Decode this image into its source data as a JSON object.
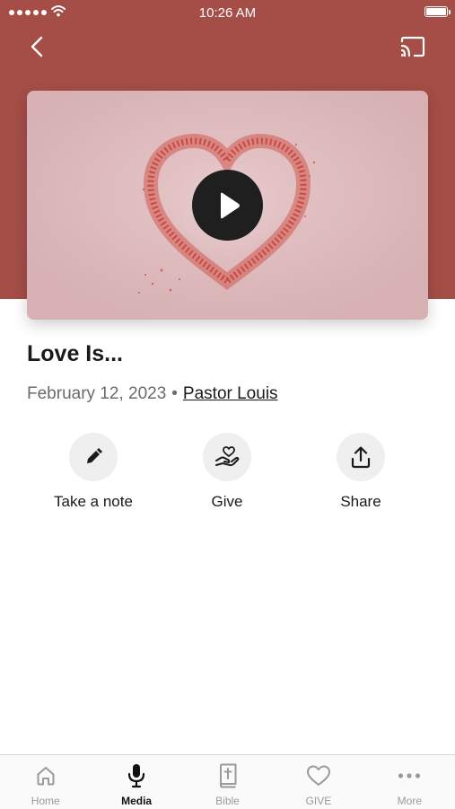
{
  "status_bar": {
    "time": "10:26 AM"
  },
  "header": {
    "accent_color": "#a54d47"
  },
  "media": {
    "title": "Love Is...",
    "date": "February 12, 2023",
    "separator": "•",
    "author": "Pastor Louis"
  },
  "actions": [
    {
      "label": "Take a note",
      "icon": "pencil-icon"
    },
    {
      "label": "Give",
      "icon": "heart-hand-icon"
    },
    {
      "label": "Share",
      "icon": "share-icon"
    }
  ],
  "tabs": [
    {
      "label": "Home",
      "icon": "home-icon",
      "active": false
    },
    {
      "label": "Media",
      "icon": "microphone-icon",
      "active": true
    },
    {
      "label": "Bible",
      "icon": "bible-icon",
      "active": false
    },
    {
      "label": "GIVE",
      "icon": "heart-icon",
      "active": false
    },
    {
      "label": "More",
      "icon": "more-icon",
      "active": false
    }
  ]
}
